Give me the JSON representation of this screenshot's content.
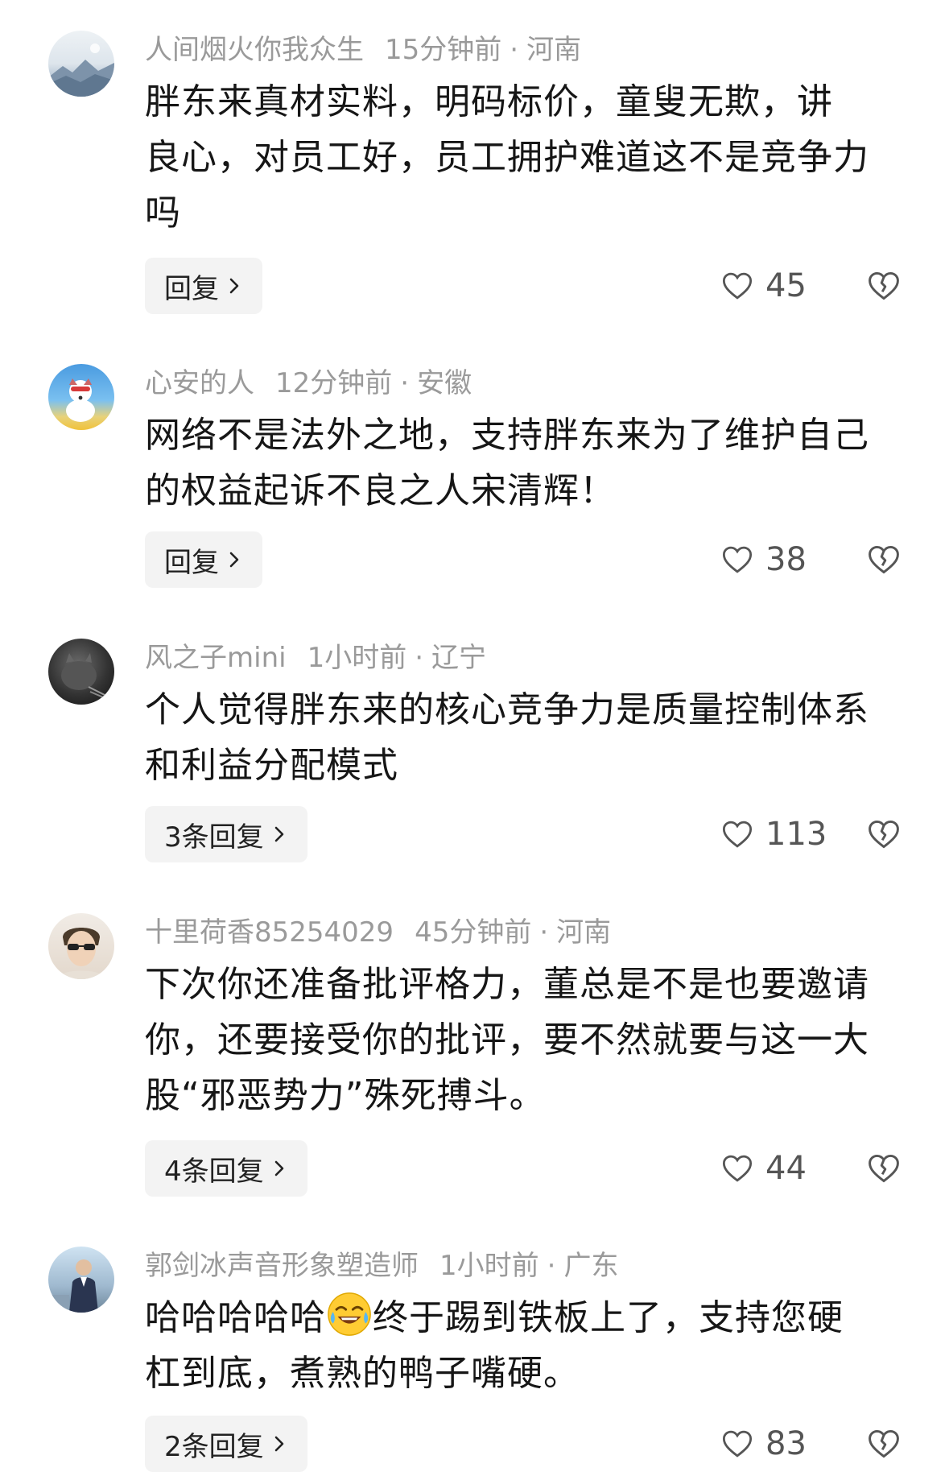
{
  "comments": [
    {
      "username": "人间烟火你我众生",
      "time": "15分钟前",
      "location": "河南",
      "lines": [
        "胖东来真材实料，明码标价，童叟无欺，讲",
        "良心，对员工好，员工拥护难道这不是竞争力",
        "吗"
      ],
      "reply_label": "回复",
      "likes": "45"
    },
    {
      "username": "心安的人",
      "time": "12分钟前",
      "location": "安徽",
      "lines": [
        "网络不是法外之地，支持胖东来为了维护自己",
        "的权益起诉不良之人宋清辉！"
      ],
      "reply_label": "回复",
      "likes": "38"
    },
    {
      "username": "风之子mini",
      "time": "1小时前",
      "location": "辽宁",
      "lines": [
        "个人觉得胖东来的核心竞争力是质量控制体系",
        "和利益分配模式"
      ],
      "reply_label": "3条回复",
      "likes": "113"
    },
    {
      "username": "十里荷香85254029",
      "time": "45分钟前",
      "location": "河南",
      "lines": [
        "下次你还准备批评格力，董总是不是也要邀请",
        "你，还要接受你的批评，要不然就要与这一大",
        "股“邪恶势力”殊死搏斗。"
      ],
      "reply_label": "4条回复",
      "likes": "44"
    },
    {
      "username": "郭剑冰声音形象塑造师",
      "time": "1小时前",
      "location": "广东",
      "line1_before_emoji": "哈哈哈哈哈",
      "emoji": "joy-emoji",
      "line1_after_emoji": "终于踢到铁板上了，支持您硬",
      "lines": [
        "杠到底，煮熟的鸭子嘴硬。"
      ],
      "reply_label": "2条回复",
      "likes": "83"
    }
  ],
  "separator": "·",
  "colors": {
    "meta": "#9a9a9a",
    "text": "#161616",
    "reply_bg": "#f3f3f3"
  }
}
